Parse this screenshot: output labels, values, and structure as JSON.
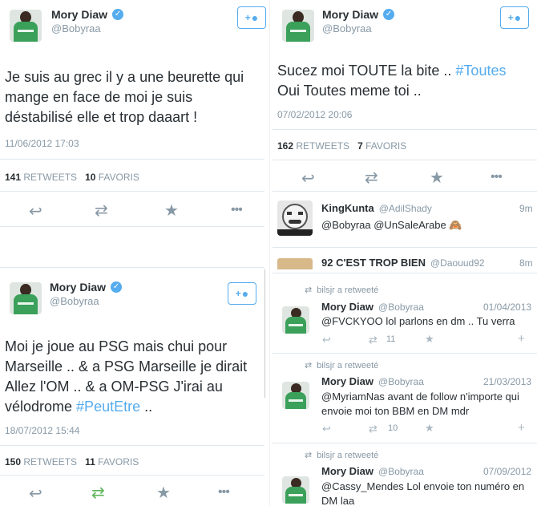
{
  "colors": {
    "accent": "#55acee",
    "text": "#292f33",
    "muted": "#8899a6",
    "retweet_green": "#5fb55a"
  },
  "tweet1": {
    "name": "Mory Diaw",
    "handle": "@Bobyraa",
    "text": "Je suis au grec il y a une beurette qui mange en face de moi je suis déstabilisé elle et trop daaart !",
    "date": "11/06/2012 17:03",
    "retweets": "141",
    "retweets_label": "RETWEETS",
    "favoris": "10",
    "favoris_label": "FAVORIS",
    "follow_plus": "+"
  },
  "tweet2": {
    "name": "Mory Diaw",
    "handle": "@Bobyraa",
    "text_before": "Sucez moi TOUTE la bite .. ",
    "hashtag": "#Toutes",
    "text_after": "Oui Toutes meme toi ..",
    "date": "07/02/2012 20:06",
    "retweets": "162",
    "retweets_label": "RETWEETS",
    "favoris": "7",
    "favoris_label": "FAVORIS",
    "follow_plus": "+"
  },
  "tweet3": {
    "name": "Mory Diaw",
    "handle": "@Bobyraa",
    "text_before": "Moi je joue au PSG mais chui pour Marseille .. & a PSG Marseille je dirait Allez l'OM .. & a OM-PSG J'irai au vélodrome ",
    "hashtag": "#PeutEtre",
    "text_after": " ..",
    "date": "18/07/2012 15:44",
    "retweets": "150",
    "retweets_label": "RETWEETS",
    "favoris": "11",
    "favoris_label": "FAVORIS",
    "follow_plus": "+"
  },
  "replies": [
    {
      "name": "KingKunta",
      "handle": "@AdilShady",
      "time": "9m",
      "text": "@Bobyraa @UnSaleArabe 🙈"
    },
    {
      "name": "92 C'EST TROP BIEN",
      "handle": "@Daouud92",
      "time": "8m"
    }
  ],
  "retweeted": [
    {
      "rt_label": "bilsjr a retweeté",
      "name": "Mory Diaw",
      "handle": "@Bobyraa",
      "date": "01/04/2013",
      "text": "@FVCKYOO lol parlons en dm .. Tu verra",
      "rt_count": "11"
    },
    {
      "rt_label": "bilsjr a retweeté",
      "name": "Mory Diaw",
      "handle": "@Bobyraa",
      "date": "21/03/2013",
      "text": "@MyriamNas avant de follow n'importe qui envoie moi ton BBM en DM mdr",
      "rt_count": "10"
    },
    {
      "rt_label": "bilsjr a retweeté",
      "name": "Mory Diaw",
      "handle": "@Bobyraa",
      "date": "07/09/2012",
      "text": "@Cassy_Mendes Lol envoie ton numéro en DM laa"
    }
  ],
  "icons": {
    "reply": "↩",
    "retweet": "⇄",
    "favorite": "★",
    "more": "•••",
    "verified": "✓",
    "person": "👤"
  }
}
